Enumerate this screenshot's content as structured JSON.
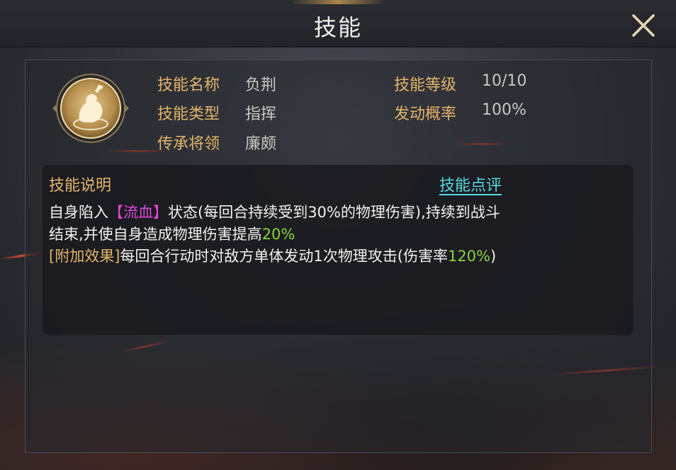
{
  "header": {
    "title": "技能"
  },
  "skill": {
    "icon": "fist-warrior-emblem-icon",
    "rows": [
      {
        "label": "技能名称",
        "value": "负荆"
      },
      {
        "label": "技能类型",
        "value": "指挥"
      },
      {
        "label": "传承将领",
        "value": "廉颇"
      },
      {
        "label": "技能等级",
        "value": "10/10"
      },
      {
        "label": "发动概率",
        "value": "100%"
      }
    ]
  },
  "description": {
    "title": "技能说明",
    "review_link": "技能点评",
    "line1_pre": "自身陷入",
    "line1_status": "【流血】",
    "line1_post": "状态(每回合持续受到30%的物理伤害),持续到战斗",
    "line2_pre": "结束,并使自身造成物理伤害提高",
    "line2_value": "20%",
    "line3_tag": "[附加效果]",
    "line3_pre": "每回合行动时对敌方单体发动1次物理攻击(伤害率",
    "line3_value": "120%",
    "line3_post": ")"
  },
  "colors": {
    "label_gold": "#e3b46a",
    "link_cyan": "#54d8e0",
    "status_pink": "#e046d8",
    "value_green": "#88d23a"
  }
}
